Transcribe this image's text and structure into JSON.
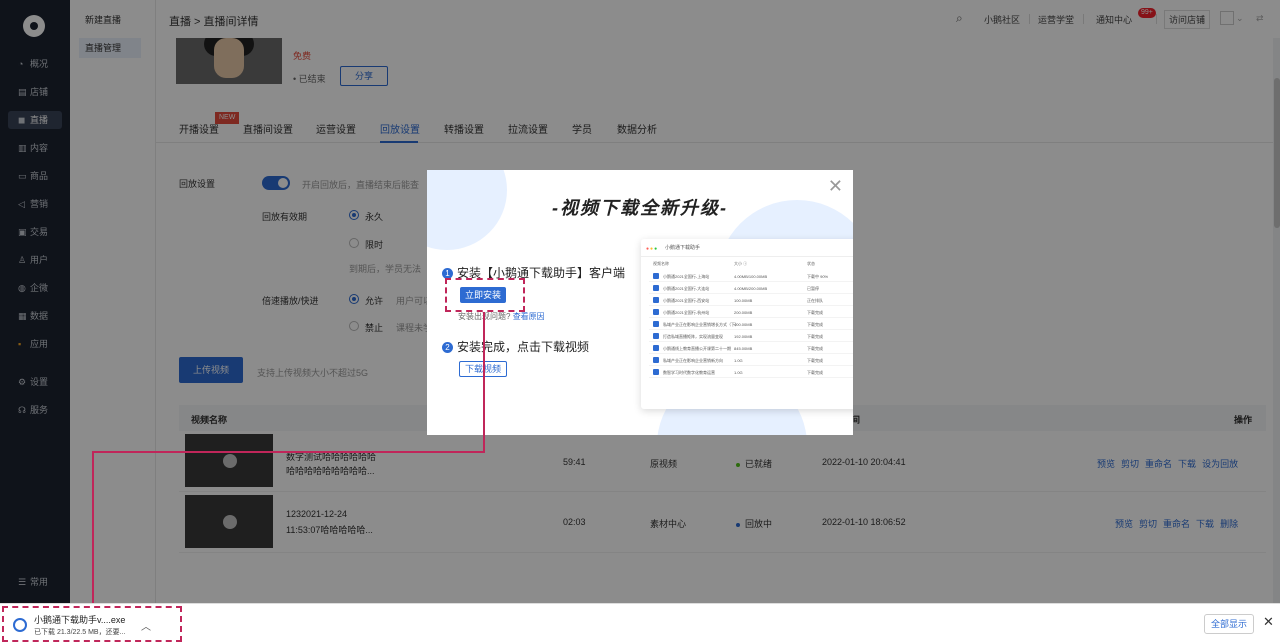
{
  "sidebar": {
    "items": [
      {
        "icon": "pie-chart-icon",
        "glyph": "◔",
        "label": "概况"
      },
      {
        "icon": "store-icon",
        "glyph": "▤",
        "label": "店铺"
      },
      {
        "icon": "live-icon",
        "glyph": "◼",
        "label": "直播"
      },
      {
        "icon": "document-icon",
        "glyph": "▥",
        "label": "内容"
      },
      {
        "icon": "goods-icon",
        "glyph": "▭",
        "label": "商品"
      },
      {
        "icon": "megaphone-icon",
        "glyph": "◁",
        "label": "营销"
      },
      {
        "icon": "trade-icon",
        "glyph": "▣",
        "label": "交易"
      },
      {
        "icon": "user-icon",
        "glyph": "♙",
        "label": "用户"
      },
      {
        "icon": "wechat-icon",
        "glyph": "◍",
        "label": "企微"
      },
      {
        "icon": "data-icon",
        "glyph": "▦",
        "label": "数据"
      },
      {
        "icon": "apps-icon",
        "glyph": "▪",
        "label": "应用"
      },
      {
        "icon": "gear-icon",
        "glyph": "⚙",
        "label": "设置"
      },
      {
        "icon": "service-icon",
        "glyph": "☊",
        "label": "服务"
      }
    ],
    "bottom": {
      "icon": "list-icon",
      "glyph": "☰",
      "label": "常用"
    }
  },
  "subnav": {
    "items": [
      "新建直播",
      "直播管理"
    ]
  },
  "topbar": {
    "breadcrumb": "直播 > 直播间详情",
    "community": "小鹅社区",
    "academy": "运营学堂",
    "notice": "通知中心",
    "notice_badge": "99+",
    "visit_store": "访问店铺"
  },
  "live": {
    "title_fragment": "免费",
    "status": "已结束",
    "share": "分享"
  },
  "tabs": [
    {
      "label": "开播设置",
      "new": "NEW"
    },
    {
      "label": "直播间设置"
    },
    {
      "label": "运营设置"
    },
    {
      "label": "回放设置"
    },
    {
      "label": "转播设置"
    },
    {
      "label": "拉流设置"
    },
    {
      "label": "学员"
    },
    {
      "label": "数据分析"
    }
  ],
  "replay": {
    "setting_label": "回放设置",
    "setting_hint": "开启回放后，直播结束后能查",
    "validity_label": "回放有效期",
    "forever": "永久",
    "limited": "限时",
    "expire_hint": "到期后，学员无法",
    "speed_label": "倍速播放/快进",
    "allow": "允许",
    "allow_hint": "用户可以",
    "forbid": "禁止",
    "forbid_hint": "课程未学"
  },
  "upload": {
    "button": "上传视频",
    "hint": "支持上传视频大小不超过5G"
  },
  "table": {
    "headers": {
      "name": "视频名称",
      "time": "间",
      "ops": "操作"
    },
    "rows": [
      {
        "title": "数字测试哈哈哈哈哈哈",
        "subtitle": "哈哈哈哈哈哈哈哈哈...",
        "duration": "59:41",
        "source": "原视频",
        "status": "已就绪",
        "status_color": "#52c41a",
        "date": "2022-01-10 20:04:41",
        "ops": [
          "预览",
          "剪切",
          "重命名",
          "下载",
          "设为回放"
        ]
      },
      {
        "title": "1232021-12-24",
        "subtitle": "11:53:07哈哈哈哈哈...",
        "duration": "02:03",
        "source": "素材中心",
        "status": "回放中",
        "status_color": "#2d6bd2",
        "date": "2022-01-10 18:06:52",
        "ops": [
          "预览",
          "剪切",
          "重命名",
          "下载",
          "删除"
        ]
      }
    ]
  },
  "modal": {
    "title": "-视频下载全新升级-",
    "step1_num": "1",
    "step1": "安装【小鹅通下载助手】客户端",
    "install": "立即安装",
    "help_prefix": "安装出现问题?",
    "help_link": "查看原因",
    "step2_num": "2",
    "step2": "安装完成，点击下载视频",
    "download": "下载视频",
    "preview": {
      "app_title": "小鹅通下载助手",
      "columns": [
        "视频名称",
        "大小 ⓘ",
        "状态"
      ],
      "rows": [
        {
          "name": "小鹅通2021全国行-上海站",
          "size": "4.00MB/100.00MB",
          "status": "下载中 90%"
        },
        {
          "name": "小鹅通2021全国行-大连站",
          "size": "4.00MB/200.00MB",
          "status": "已暂停"
        },
        {
          "name": "小鹅通2021全国行-西安站",
          "size": "100.00MB",
          "status": "正在排队"
        },
        {
          "name": "小鹅通2021全国行-杭州站",
          "size": "200.00MB",
          "status": "下载完成"
        },
        {
          "name": "私域产业正在影响企业营销增长方式（下）",
          "size": "400.00MB",
          "status": "下载完成"
        },
        {
          "name": "打造私域直播矩阵，实现流量变现",
          "size": "192.00MB",
          "status": "下载完成"
        },
        {
          "name": "小鹅通线上教育直播公开课第二十一期",
          "size": "845.00MB",
          "status": "下载完成"
        },
        {
          "name": "私域产业正在影响企业营销新方向",
          "size": "1.0G",
          "status": "下载完成"
        },
        {
          "name": "数智学习时代数字化教育运营",
          "size": "1.0G",
          "status": "下载完成"
        }
      ]
    }
  },
  "download_bar": {
    "file_name": "小鹅通下载助手v....exe",
    "progress": "已下载 21.3/22.5 MB，还要...",
    "show_all": "全部显示"
  },
  "colors": {
    "primary": "#2d6bd2",
    "highlight": "#c0265a",
    "sidebar": "#1c2331"
  }
}
